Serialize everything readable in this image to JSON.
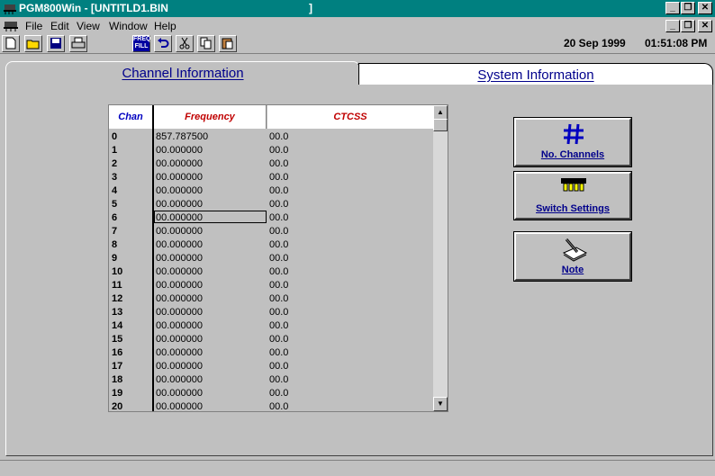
{
  "window": {
    "title": "PGM800Win - [UNTITLD1.BIN",
    "title_tail": "]"
  },
  "menu": {
    "items": [
      "File",
      "Edit",
      "View",
      "Window",
      "Help"
    ]
  },
  "toolbar": {
    "date": "20 Sep 1999",
    "time": "01:51:08 PM",
    "freq_fill_line1": "FREQ",
    "freq_fill_line2": "FILL"
  },
  "tabs": {
    "channel": "Channel Information",
    "system": "System Information"
  },
  "grid": {
    "headers": {
      "chan": "Chan",
      "frequency": "Frequency",
      "ctcss": "CTCSS"
    },
    "rows": [
      [
        "0",
        "857.787500",
        "00.0"
      ],
      [
        "1",
        "00.000000",
        "00.0"
      ],
      [
        "2",
        "00.000000",
        "00.0"
      ],
      [
        "3",
        "00.000000",
        "00.0"
      ],
      [
        "4",
        "00.000000",
        "00.0"
      ],
      [
        "5",
        "00.000000",
        "00.0"
      ],
      [
        "6",
        "00.000000",
        "00.0"
      ],
      [
        "7",
        "00.000000",
        "00.0"
      ],
      [
        "8",
        "00.000000",
        "00.0"
      ],
      [
        "9",
        "00.000000",
        "00.0"
      ],
      [
        "10",
        "00.000000",
        "00.0"
      ],
      [
        "11",
        "00.000000",
        "00.0"
      ],
      [
        "12",
        "00.000000",
        "00.0"
      ],
      [
        "13",
        "00.000000",
        "00.0"
      ],
      [
        "14",
        "00.000000",
        "00.0"
      ],
      [
        "15",
        "00.000000",
        "00.0"
      ],
      [
        "16",
        "00.000000",
        "00.0"
      ],
      [
        "17",
        "00.000000",
        "00.0"
      ],
      [
        "18",
        "00.000000",
        "00.0"
      ],
      [
        "19",
        "00.000000",
        "00.0"
      ],
      [
        "20",
        "00.000000",
        "00.0"
      ]
    ],
    "selected_row": 6
  },
  "buttons": {
    "no_channels": "No. Channels",
    "switch_settings": "Switch Settings",
    "note": "Note"
  },
  "colors": {
    "title_bar": "#008080",
    "tab_text": "#00008b",
    "header_chan": "#0000c0",
    "header_other": "#c00000"
  }
}
